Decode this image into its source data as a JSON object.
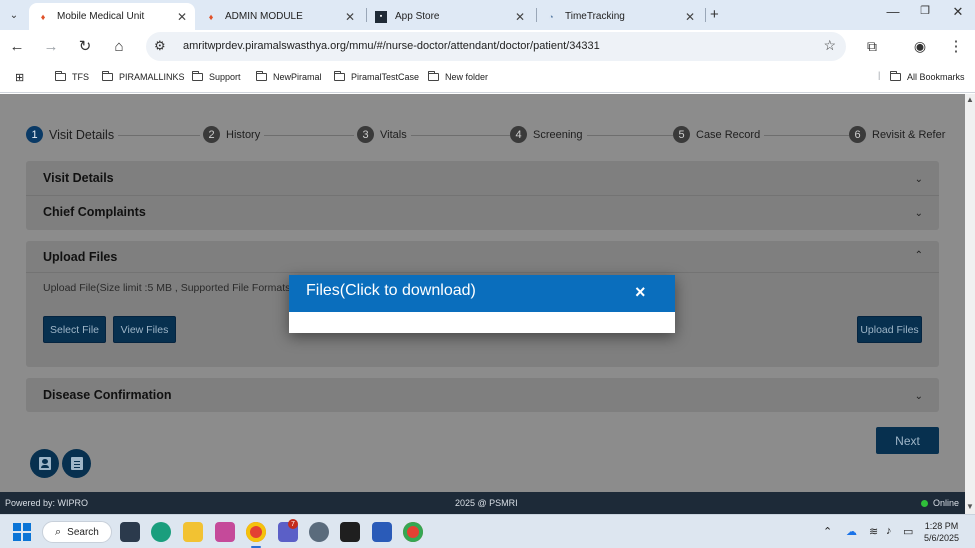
{
  "browser": {
    "tabs": [
      {
        "label": "Mobile Medical Unit",
        "active": true
      },
      {
        "label": "ADMIN MODULE",
        "active": false
      },
      {
        "label": "App Store",
        "active": false
      },
      {
        "label": "TimeTracking",
        "active": false
      }
    ],
    "url": "amritwprdev.piramalswasthya.org/mmu/#/nurse-doctor/attendant/doctor/patient/34331",
    "bookmarks": [
      "TFS",
      "PIRAMALLINKS",
      "Support",
      "NewPiramal",
      "PiramalTestCase",
      "New folder"
    ],
    "all_bookmarks": "All Bookmarks"
  },
  "stepper": {
    "steps": [
      {
        "num": "1",
        "label": "Visit Details"
      },
      {
        "num": "2",
        "label": "History"
      },
      {
        "num": "3",
        "label": "Vitals"
      },
      {
        "num": "4",
        "label": "Screening"
      },
      {
        "num": "5",
        "label": "Case Record"
      },
      {
        "num": "6",
        "label": "Revisit & Refer"
      }
    ]
  },
  "panels": {
    "visit_details": "Visit Details",
    "chief_complaints": "Chief Complaints",
    "upload_files": "Upload Files",
    "upload_desc": "Upload File(Size limit :5 MB , Supported File Formats",
    "select_file": "Select File",
    "view_files": "View Files",
    "upload_button": "Upload Files",
    "disease_confirmation": "Disease Confirmation"
  },
  "next_label": "Next",
  "modal": {
    "title": "Files(Click to download)",
    "close": "×"
  },
  "footer": {
    "powered_by": "Powered by: WIPRO",
    "copyright": "2025 @ PSMRI",
    "status": "Online"
  },
  "taskbar": {
    "search": "Search",
    "teams_badge": "7",
    "time": "1:28 PM",
    "date": "5/6/2025"
  },
  "colors": {
    "accent": "#0a6ebd",
    "button": "#07304f",
    "footer": "#1d2a38",
    "online": "#2fbf3a"
  }
}
